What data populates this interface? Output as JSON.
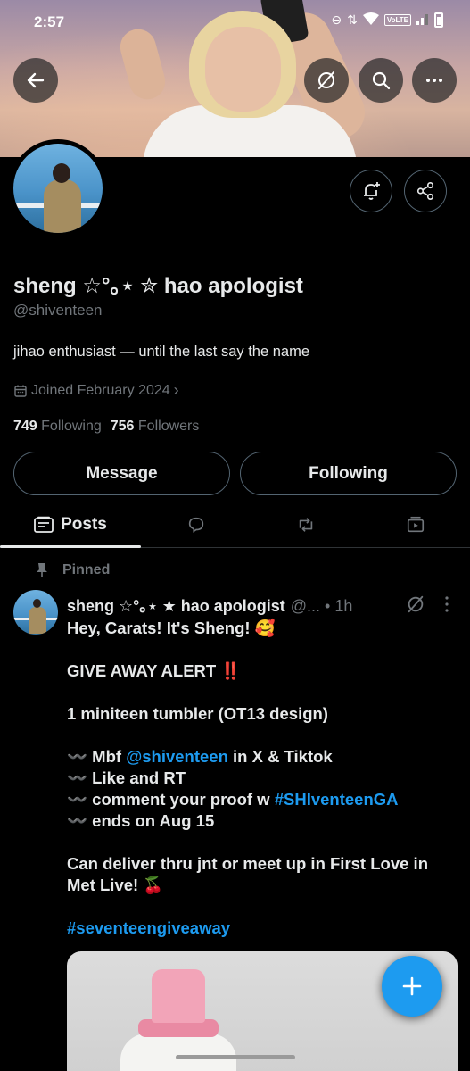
{
  "status": {
    "time": "2:57",
    "network_label": "VoLTE"
  },
  "header": {
    "back_icon": "arrow-left-icon",
    "action_icons": [
      "grok-icon",
      "search-icon",
      "more-icon"
    ]
  },
  "profile": {
    "display_name": "sheng ☆°｡⋆ ✮ hao apologist",
    "handle": "@shiventeen",
    "bio": "jihao enthusiast — until the last say the name",
    "joined": "Joined February 2024",
    "following_count": "749",
    "following_label": "Following",
    "followers_count": "756",
    "followers_label": "Followers",
    "message_button": "Message",
    "following_button": "Following"
  },
  "tabs": {
    "active_label": "Posts",
    "items": [
      "Posts",
      "Replies",
      "Reposts",
      "Media"
    ]
  },
  "tweet": {
    "pinned_label": "Pinned",
    "author_name": "sheng ☆°｡⋆ ★ hao apologist",
    "author_meta": "@... • 1h",
    "line1": "Hey, Carats! It's Sheng! 🥰",
    "line2": "GIVE AWAY ALERT ‼️",
    "line3": "1 miniteen tumbler (OT13 design)",
    "bullet1_prefix": "〰️ Mbf ",
    "bullet1_link": "@shiventeen",
    "bullet1_suffix": " in X & Tiktok",
    "bullet2": "〰️ Like and RT",
    "bullet3_prefix": "〰️ comment your proof w ",
    "bullet3_link": "#SHIventeenGA",
    "bullet4": "〰️ ends on Aug 15",
    "line4a": "Can deliver thru jnt or meet up in First Love in",
    "line4b": "Met Live! 🍒",
    "hashtag": "#seventeengiveaway"
  },
  "colors": {
    "accent": "#1d9bf0",
    "background": "#000000",
    "text_primary": "#e7e9ea",
    "text_secondary": "#71767b",
    "border": "#536471"
  }
}
